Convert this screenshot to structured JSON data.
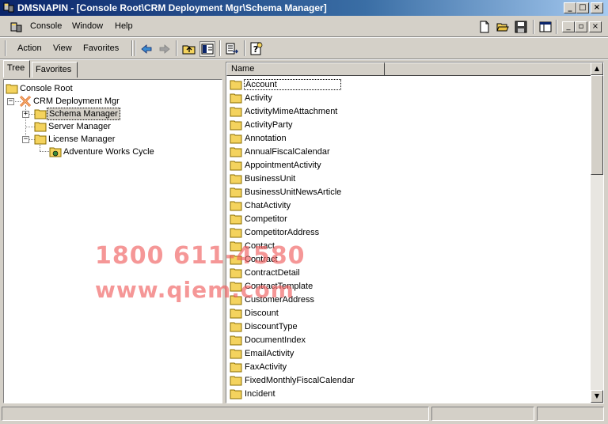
{
  "window": {
    "title": "DMSNAPIN - [Console Root\\CRM Deployment Mgr\\Schema Manager]",
    "caption_buttons": [
      "_",
      "□",
      "×"
    ],
    "child_caption_buttons": [
      "_",
      "▫",
      "×"
    ]
  },
  "menubar": {
    "items": [
      {
        "label": "Console"
      },
      {
        "label": "Window"
      },
      {
        "label": "Help"
      }
    ]
  },
  "toolbar": {
    "items": [
      {
        "label": "Action"
      },
      {
        "label": "View"
      },
      {
        "label": "Favorites"
      }
    ],
    "icons": [
      "back-arrow-icon",
      "forward-arrow-icon",
      "up-folder-icon",
      "show-hide-tree-icon",
      "export-list-icon",
      "help-icon",
      "new-icon",
      "open-icon",
      "save-icon",
      "console-window-icon"
    ]
  },
  "tabs": [
    {
      "label": "Tree",
      "active": true
    },
    {
      "label": "Favorites",
      "active": false
    }
  ],
  "tree": [
    {
      "label": "Console Root"
    },
    {
      "label": "CRM Deployment Mgr"
    },
    {
      "label": "Schema Manager",
      "selected": true
    },
    {
      "label": "Server Manager"
    },
    {
      "label": "License Manager"
    },
    {
      "label": "Adventure Works Cycle"
    }
  ],
  "list": {
    "column": "Name",
    "items": [
      "Account",
      "Activity",
      "ActivityMimeAttachment",
      "ActivityParty",
      "Annotation",
      "AnnualFiscalCalendar",
      "AppointmentActivity",
      "BusinessUnit",
      "BusinessUnitNewsArticle",
      "ChatActivity",
      "Competitor",
      "CompetitorAddress",
      "Contact",
      "Contract",
      "ContractDetail",
      "ContractTemplate",
      "CustomerAddress",
      "Discount",
      "DiscountType",
      "DocumentIndex",
      "EmailActivity",
      "FaxActivity",
      "FixedMonthlyFiscalCalendar",
      "Incident"
    ]
  },
  "watermark": {
    "line1": "1800 611-4580",
    "line2": "www.qiem.com"
  },
  "colors": {
    "titlebar_start": "#0a246a",
    "titlebar_end": "#a6caf0",
    "folder": "#f4d35e",
    "watermark": "#f06060"
  }
}
